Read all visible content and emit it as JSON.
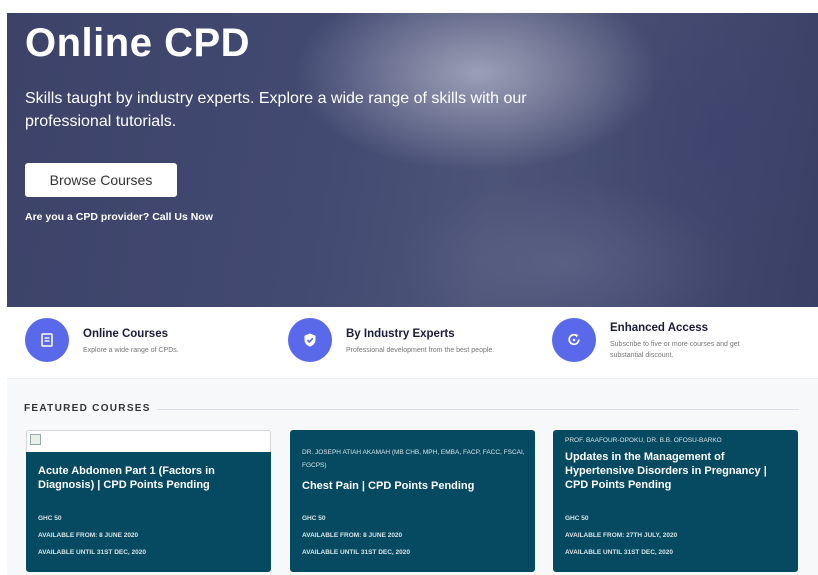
{
  "hero": {
    "title": "Online CPD",
    "subtitle": "Skills taught by industry experts. Explore a wide range of skills with our professional tutorials.",
    "browse_button": "Browse Courses",
    "provider_link": "Are you a CPD provider? Call Us Now"
  },
  "features": [
    {
      "title": "Online Courses",
      "description": "Explore a wide range of CPDs.",
      "icon": "book-icon"
    },
    {
      "title": "By Industry Experts",
      "description": "Professional development from the best people.",
      "icon": "shield-check-icon"
    },
    {
      "title": "Enhanced Access",
      "description": "Subscribe to five or more courses and get substantial discount.",
      "icon": "refresh-icon"
    }
  ],
  "featured": {
    "heading": "FEATURED COURSES",
    "courses": [
      {
        "authors": "",
        "title": "Acute Abdomen Part 1 (Factors in Diagnosis) | CPD Points Pending",
        "price": "GHC 50",
        "available_from": "AVAILABLE FROM: 8 JUNE 2020",
        "available_until": "AVAILABLE UNTIL 31ST DEC, 2020"
      },
      {
        "authors": "DR. JOSEPH ATIAH AKAMAH (MB CHB, MPH, EMBA, FACP, FACC, FSCAI, FGCPS)",
        "title": "Chest Pain | CPD Points Pending",
        "price": "GHC 50",
        "available_from": "AVAILABLE FROM: 8 JUNE 2020",
        "available_until": "AVAILABLE UNTIL 31ST DEC, 2020"
      },
      {
        "authors": "PROF. BAAFOUR-OPOKU, DR. B.B. OFOSU-BARKO",
        "title": "Updates in the Management of Hypertensive Disorders in Pregnancy | CPD Points Pending",
        "price": "GHC 50",
        "available_from": "AVAILABLE FROM: 27TH JULY, 2020",
        "available_until": "AVAILABLE UNTIL 31ST DEC, 2020"
      }
    ]
  },
  "colors": {
    "accent": "#5a68ea",
    "card_bg": "#064a62",
    "hero_bg": "#434a72"
  }
}
